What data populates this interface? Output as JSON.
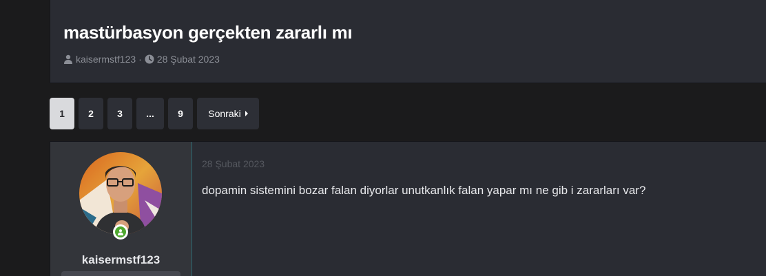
{
  "thread": {
    "title": "mastürbasyon gerçekten zararlı mı",
    "author": "kaisermstf123",
    "separator": "·",
    "date": "28 Şubat 2023",
    "icons": {
      "author": "user-icon",
      "date": "clock-icon"
    }
  },
  "pagination": {
    "pages": [
      "1",
      "2",
      "3",
      "...",
      "9"
    ],
    "active": "1",
    "next_label": "Sonraki"
  },
  "post": {
    "date": "28 Şubat 2023",
    "text": "dopamin sistemini bozar falan diyorlar unutkanlık falan yapar mı ne gib i zararları var?",
    "username": "kaisermstf123",
    "status": "online"
  },
  "colors": {
    "background": "#1b1b1c",
    "card": "#2a2c33",
    "user_panel": "#33353a",
    "online": "#4fa830",
    "active_page": "#d9dadd"
  }
}
